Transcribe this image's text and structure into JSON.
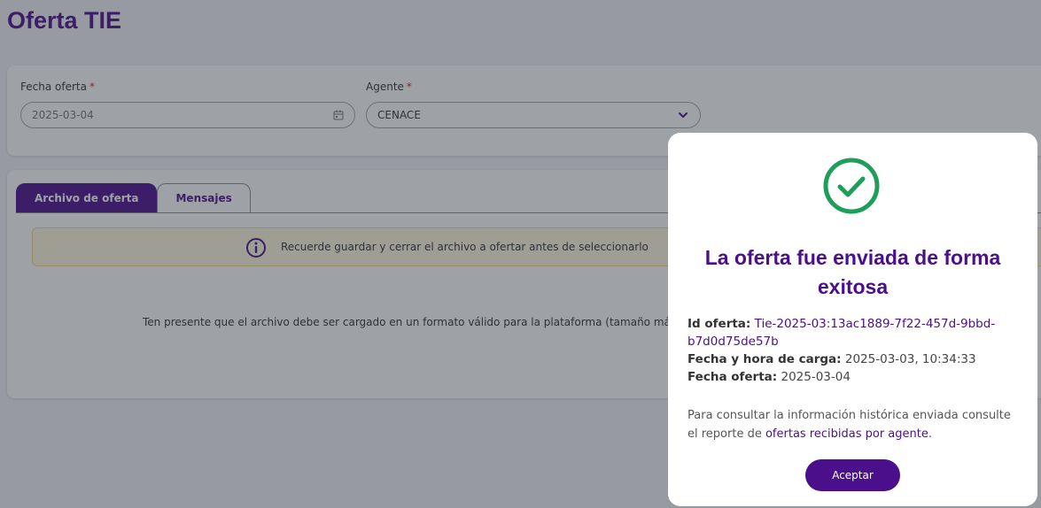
{
  "page": {
    "title": "Oferta TIE"
  },
  "form": {
    "fecha_label": "Fecha oferta",
    "fecha_value": "2025-03-04",
    "agente_label": "Agente",
    "agente_value": "CENACE",
    "required_mark": "*"
  },
  "tabs": [
    {
      "label": "Archivo de oferta",
      "active": true
    },
    {
      "label": "Mensajes",
      "active": false
    }
  ],
  "notice": {
    "icon": "info-icon",
    "text": "Recuerde guardar y cerrar el archivo a ofertar antes de seleccionarlo"
  },
  "help_text": "Ten presente que el archivo debe ser cargado en un formato válido para la plataforma (tamaño máxim",
  "modal": {
    "icon": "check-circle-icon",
    "title": "La oferta fue enviada de forma exitosa",
    "id_label": "Id oferta:",
    "id_value": "Tie-2025-03:13ac1889-7f22-457d-9bbd-b7d0d75de57b",
    "upload_label": "Fecha y hora de carga:",
    "upload_value": "2025-03-03, 10:34:33",
    "fecha_label": "Fecha oferta:",
    "fecha_value": "2025-03-04",
    "note_prefix": "Para consultar la información histórica enviada consulte el reporte de",
    "note_link": "ofertas recibidas por agente",
    "note_suffix": ".",
    "accept_label": "Aceptar"
  },
  "colors": {
    "brand_purple": "#4b0f8c",
    "success_green": "#1e9e5a",
    "notice_bg": "#fff8e1",
    "required_red": "#d12a2a"
  }
}
